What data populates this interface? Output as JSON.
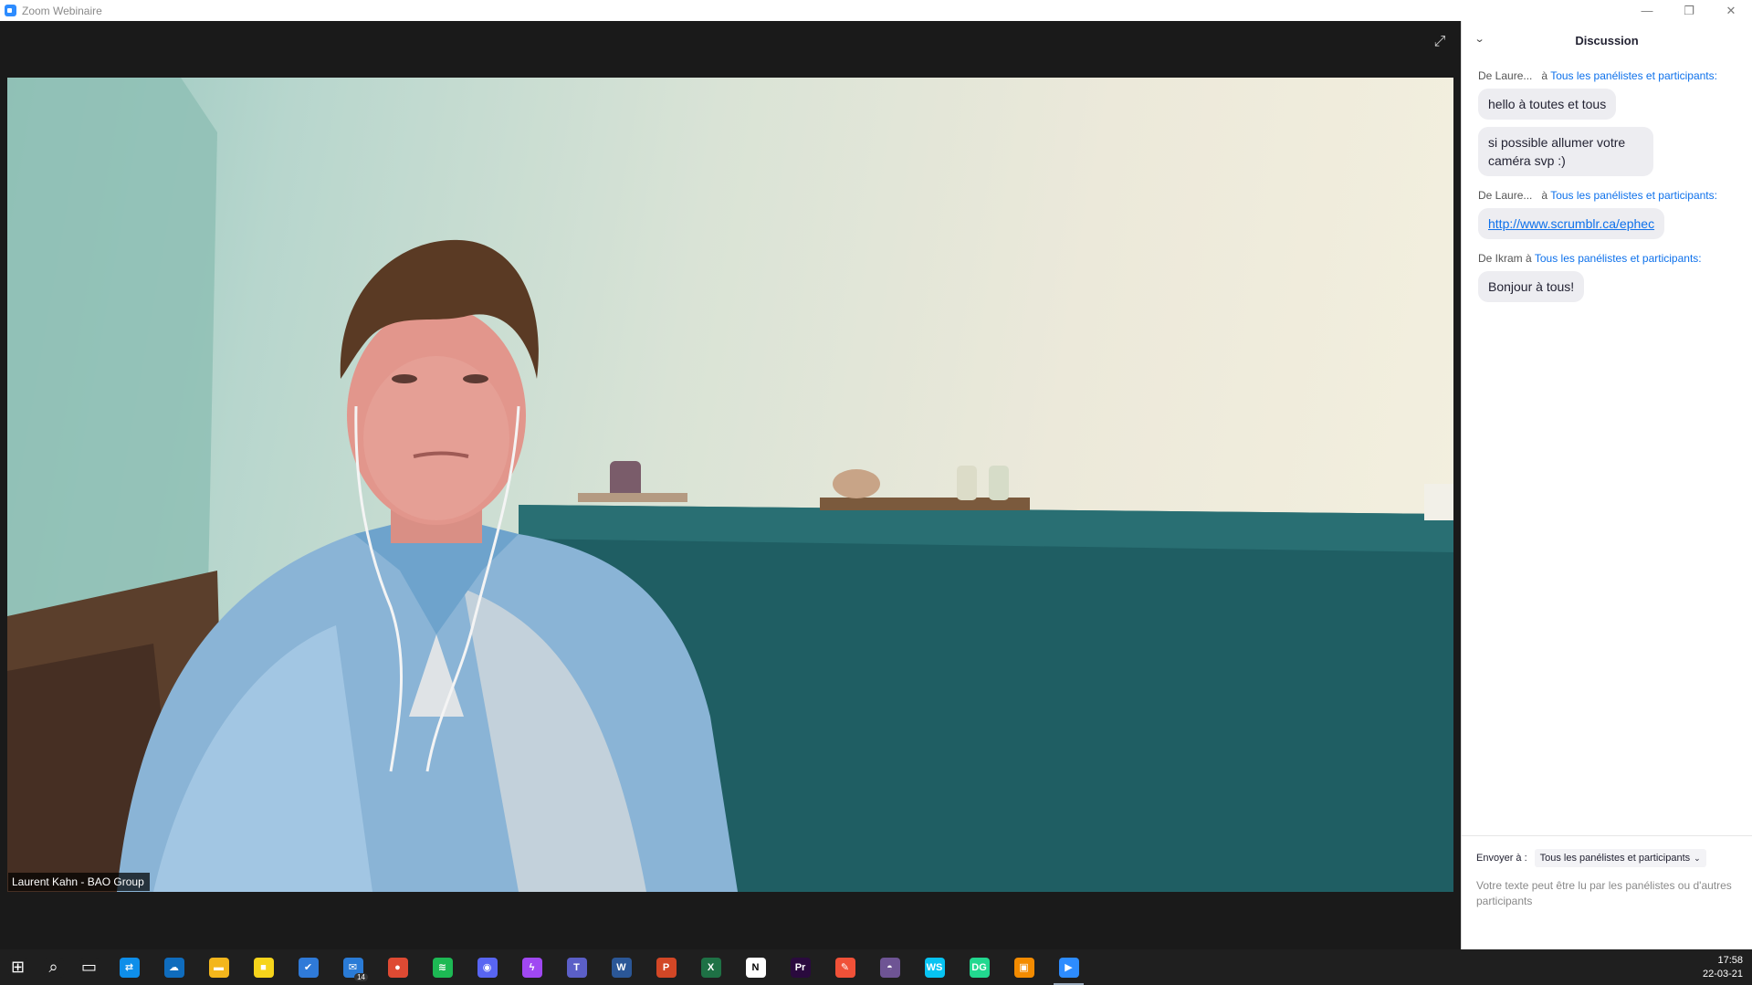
{
  "window": {
    "title": "Zoom Webinaire",
    "controls": {
      "minimize": "—",
      "restore": "❐",
      "close": "✕"
    }
  },
  "video": {
    "participant_name": "Laurent Kahn  - BAO Group",
    "expand_icon": "⤢"
  },
  "chat": {
    "title": "Discussion",
    "collapse_icon": "⌄",
    "messages": [
      {
        "from": "De Laure...",
        "to_prefix": "à",
        "to": "Tous les panélistes et participants:",
        "bubbles": [
          "hello à toutes et tous",
          "si possible allumer votre caméra svp :)"
        ]
      },
      {
        "from": "De Laure...",
        "to_prefix": "à",
        "to": "Tous les panélistes et participants:",
        "link": "http://www.scrumblr.ca/ephec"
      },
      {
        "from": "De Ikram",
        "to_prefix": "à",
        "to": "Tous les panélistes et participants:",
        "bubbles": [
          "Bonjour à tous!"
        ]
      }
    ],
    "send_to_label": "Envoyer à :",
    "send_to_value": "Tous les panélistes et participants",
    "input_placeholder": "Votre texte peut être lu par les panélistes ou d'autres participants"
  },
  "taskbar": {
    "apps": [
      {
        "name": "start-icon",
        "glyph": "⊞",
        "color": "#1f1f1f"
      },
      {
        "name": "search-icon",
        "glyph": "⌕",
        "color": "#1f1f1f"
      },
      {
        "name": "task-view-icon",
        "glyph": "▭",
        "color": "#1f1f1f"
      },
      {
        "name": "teamviewer-icon",
        "glyph": "⇄",
        "color": "#0e8ee9"
      },
      {
        "name": "onedrive-icon",
        "glyph": "☁",
        "color": "#0f6cbd"
      },
      {
        "name": "file-explorer-icon",
        "glyph": "▬",
        "color": "#f3b61c"
      },
      {
        "name": "sticky-notes-icon",
        "glyph": "■",
        "color": "#f6d41b"
      },
      {
        "name": "todo-icon",
        "glyph": "✔",
        "color": "#2f7ad8"
      },
      {
        "name": "mail-icon",
        "glyph": "✉",
        "color": "#2a7bd6",
        "badge": "14"
      },
      {
        "name": "chrome-icon",
        "glyph": "●",
        "color": "#de4a33"
      },
      {
        "name": "spotify-icon",
        "glyph": "≋",
        "color": "#1db954"
      },
      {
        "name": "discord-icon",
        "glyph": "◉",
        "color": "#5865f2"
      },
      {
        "name": "messenger-icon",
        "glyph": "ϟ",
        "color": "#a048f2"
      },
      {
        "name": "teams-icon",
        "glyph": "T",
        "color": "#5b5fc7"
      },
      {
        "name": "word-icon",
        "glyph": "W",
        "color": "#2b5797"
      },
      {
        "name": "powerpoint-icon",
        "glyph": "P",
        "color": "#d24726"
      },
      {
        "name": "excel-icon",
        "glyph": "X",
        "color": "#1e7145"
      },
      {
        "name": "notion-icon",
        "glyph": "N",
        "color": "#ffffff"
      },
      {
        "name": "premiere-icon",
        "glyph": "Pr",
        "color": "#2a0a3e"
      },
      {
        "name": "swift-icon",
        "glyph": "✎",
        "color": "#f05138"
      },
      {
        "name": "github-icon",
        "glyph": "◓",
        "color": "#6e5494"
      },
      {
        "name": "webstorm-icon",
        "glyph": "WS",
        "color": "#07c3f2"
      },
      {
        "name": "datagrip-icon",
        "glyph": "DG",
        "color": "#22d88f"
      },
      {
        "name": "vmware-icon",
        "glyph": "▣",
        "color": "#f38b00"
      },
      {
        "name": "zoom-icon",
        "glyph": "▶",
        "color": "#2d8cff"
      }
    ],
    "clock": {
      "time": "17:58",
      "date": "22-03-21"
    }
  },
  "colors": {
    "accent": "#0e71eb",
    "bubble_bg": "#ededf1",
    "taskbar_bg": "#1f1f1f"
  }
}
